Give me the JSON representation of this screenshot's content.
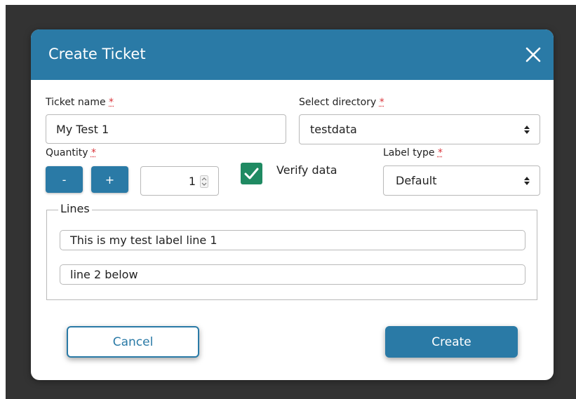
{
  "colors": {
    "primary": "#2a7aa6",
    "checkbox": "#1f8a62",
    "required": "#d9343a"
  },
  "dialog": {
    "title": "Create Ticket",
    "close_icon": "close-icon"
  },
  "form": {
    "ticket_name": {
      "label": "Ticket name",
      "required_mark": "*",
      "value": "My Test 1"
    },
    "directory": {
      "label": "Select directory",
      "required_mark": "*",
      "selected": "testdata"
    },
    "quantity": {
      "label": "Quantity",
      "required_mark": "*",
      "minus_label": "-",
      "plus_label": "+",
      "value": "1"
    },
    "verify": {
      "label": "Verify data",
      "checked": true
    },
    "label_type": {
      "label": "Label type",
      "required_mark": "*",
      "selected": "Default"
    },
    "lines": {
      "legend": "Lines",
      "items": [
        {
          "value": "This is my test label line 1"
        },
        {
          "value": "line 2 below"
        }
      ]
    }
  },
  "actions": {
    "cancel_label": "Cancel",
    "create_label": "Create"
  }
}
